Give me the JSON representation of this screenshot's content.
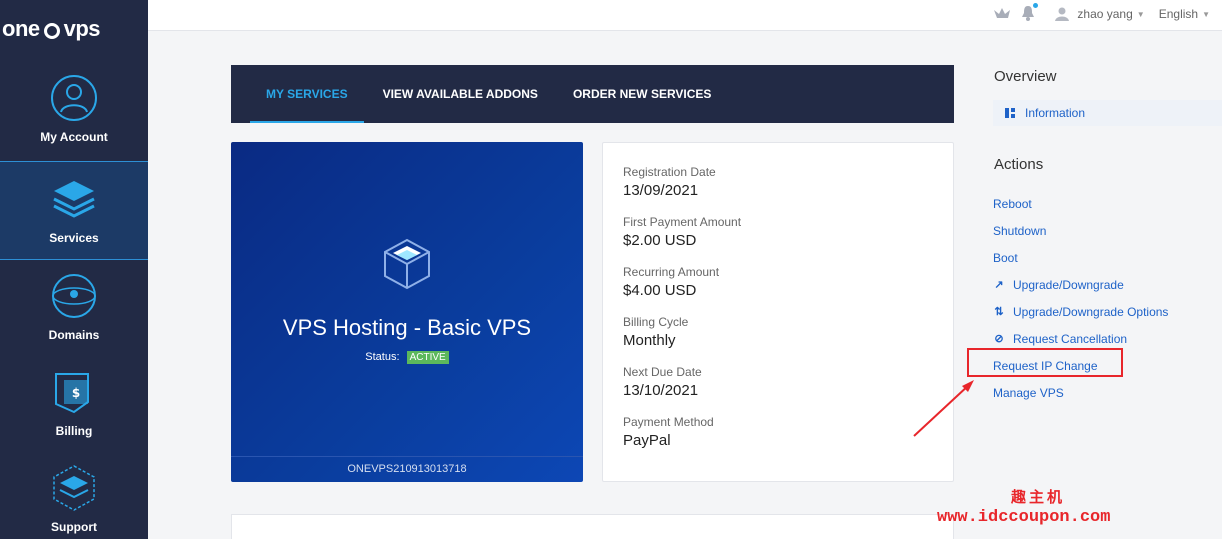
{
  "brand": {
    "part1": "one",
    "part2": "vps"
  },
  "sidebar": {
    "items": [
      {
        "label": "My Account",
        "icon": "user-icon"
      },
      {
        "label": "Services",
        "icon": "layers-icon"
      },
      {
        "label": "Domains",
        "icon": "globe-icon"
      },
      {
        "label": "Billing",
        "icon": "billing-icon"
      },
      {
        "label": "Support",
        "icon": "support-icon"
      }
    ]
  },
  "topbar": {
    "user_name": "zhao yang",
    "language": "English"
  },
  "tabs": [
    {
      "label": "MY SERVICES",
      "active": true
    },
    {
      "label": "VIEW AVAILABLE ADDONS"
    },
    {
      "label": "ORDER NEW SERVICES"
    }
  ],
  "product": {
    "name": "VPS Hosting - Basic VPS",
    "status_label": "Status:",
    "status_value": "ACTIVE",
    "service_id": "ONEVPS210913013718"
  },
  "details": [
    {
      "label": "Registration Date",
      "value": "13/09/2021"
    },
    {
      "label": "First Payment Amount",
      "value": "$2.00 USD"
    },
    {
      "label": "Recurring Amount",
      "value": "$4.00 USD"
    },
    {
      "label": "Billing Cycle",
      "value": "Monthly"
    },
    {
      "label": "Next Due Date",
      "value": "13/10/2021"
    },
    {
      "label": "Payment Method",
      "value": "PayPal"
    }
  ],
  "overview": {
    "title": "Overview",
    "information": "Information"
  },
  "actions": {
    "title": "Actions",
    "items": [
      "Reboot",
      "Shutdown",
      "Boot",
      "Upgrade/Downgrade",
      "Upgrade/Downgrade Options",
      "Request Cancellation",
      "Request IP Change",
      "Manage VPS"
    ]
  },
  "watermark": {
    "cn": "趣主机",
    "url": "www.idccoupon.com"
  },
  "colors": {
    "accent": "#2aa7e8",
    "sidebar": "#222a45",
    "link": "#1e62c8",
    "annotation": "#e8262b",
    "active_badge": "#5cb85c"
  }
}
